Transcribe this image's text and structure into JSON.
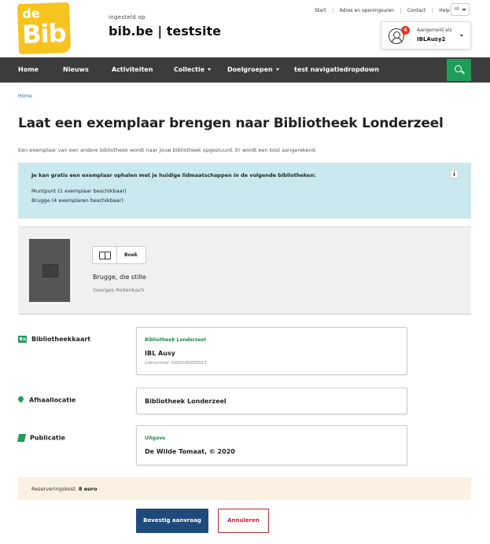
{
  "header": {
    "logo_text_top": "de",
    "logo_text_main": "Bib",
    "logged_in_label": "ingesteld op",
    "site_name": "bib.be | testsite",
    "top_links": [
      "Start",
      "Adres en openingsuren",
      "Contact",
      "Help"
    ],
    "language": "nl",
    "user": {
      "badge_count": "4",
      "label": "Aangemeld als",
      "name": "IBLAusy2"
    }
  },
  "nav": {
    "items": [
      {
        "label": "Home",
        "dropdown": false
      },
      {
        "label": "Nieuws",
        "dropdown": false
      },
      {
        "label": "Activiteiten",
        "dropdown": false
      },
      {
        "label": "Collectie",
        "dropdown": true
      },
      {
        "label": "Doelgroepen",
        "dropdown": true
      },
      {
        "label": "test navigatiedropdown",
        "dropdown": false
      }
    ],
    "search_icon": "search-icon"
  },
  "breadcrumb": "Home",
  "page": {
    "title": "Laat een exemplaar brengen naar Bibliotheek Londerzeel",
    "intro": "Een exemplaar van een andere bibliotheek wordt naar jouw bibliotheek opgestuurd. Er wordt een kost aangerekend."
  },
  "info": {
    "title": "Je kan gratis een exemplaar ophalen met je huidige lidmaatschappen in de volgende bibliotheken:",
    "lines": [
      "Muntpunt (1 exemplaar beschikbaar)",
      "Brugge (4 exemplaren beschikbaar)"
    ],
    "icon": "info-icon"
  },
  "book": {
    "type": "Boek",
    "title": "Brugge, die stille",
    "author": "Georges Rodenbach"
  },
  "fields": {
    "card": {
      "label": "Bibliotheekkaart",
      "library": "Bibliotheek Londerzeel",
      "holder": "IBL Ausy",
      "member_number": "Lidnummer 2000100055023"
    },
    "pickup": {
      "label": "Afhaallocatie",
      "value": "Bibliotheek Londerzeel"
    },
    "publication": {
      "label": "Publicatie",
      "small_label": "Uitgave",
      "value": "De Wilde Tomaat, © 2020"
    }
  },
  "cost": {
    "label": "Reserveringskost:",
    "value": "8 euro"
  },
  "actions": {
    "confirm": "Bevestig aanvraag",
    "cancel": "Annuleren"
  },
  "colors": {
    "accent_green": "#1e9e58",
    "nav_bg": "#3c3c3c",
    "logo_yellow": "#f7c31e",
    "info_bg": "#c9e9ee",
    "confirm_blue": "#1f4a7c",
    "cancel_red": "#c0282e"
  }
}
